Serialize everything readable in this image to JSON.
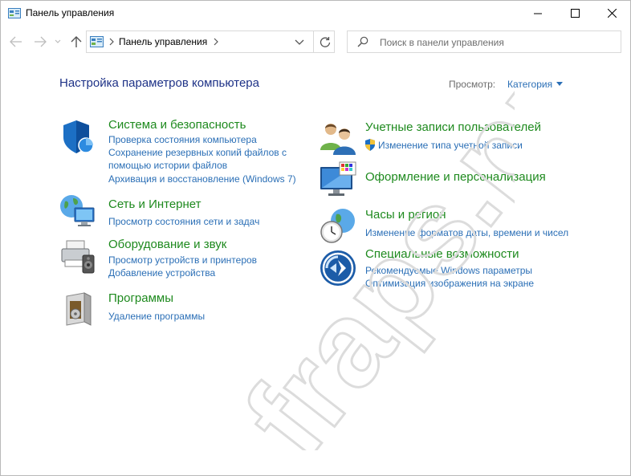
{
  "window": {
    "title": "Панель управления",
    "buttons": {
      "minimize": "minimize",
      "maximize": "maximize",
      "close": "close"
    }
  },
  "nav": {
    "address": "Панель управления",
    "search_placeholder": "Поиск в панели управления"
  },
  "main": {
    "heading": "Настройка параметров компьютера",
    "view_label": "Просмотр:",
    "view_value": "Категория"
  },
  "categories": {
    "system": {
      "title": "Система и безопасность",
      "links": [
        "Проверка состояния компьютера",
        "Сохранение резервных копий файлов с",
        "помощью истории файлов",
        "Архивация и восстановление (Windows 7)"
      ]
    },
    "network": {
      "title": "Сеть и Интернет",
      "links": [
        "Просмотр состояния сети и задач"
      ]
    },
    "hardware": {
      "title": "Оборудование и звук",
      "links": [
        "Просмотр устройств и принтеров",
        "Добавление устройства"
      ]
    },
    "programs": {
      "title": "Программы",
      "links": [
        "Удаление программы"
      ]
    },
    "accounts": {
      "title": "Учетные записи пользователей",
      "links": [
        "Изменение типа учетной записи"
      ]
    },
    "appearance": {
      "title": "Оформление и персонализация",
      "links": []
    },
    "clock": {
      "title": "Часы и регион",
      "links": [
        "Изменение форматов даты, времени и чисел"
      ]
    },
    "access": {
      "title": "Специальные возможности",
      "links": [
        "Рекомендуемые Windows параметры",
        "Оптимизация изображения на экране"
      ]
    }
  },
  "watermark": "fraps.pro",
  "colors": {
    "link": "#2b6fb6",
    "category": "#1e8a1e",
    "heading": "#1e3287"
  }
}
